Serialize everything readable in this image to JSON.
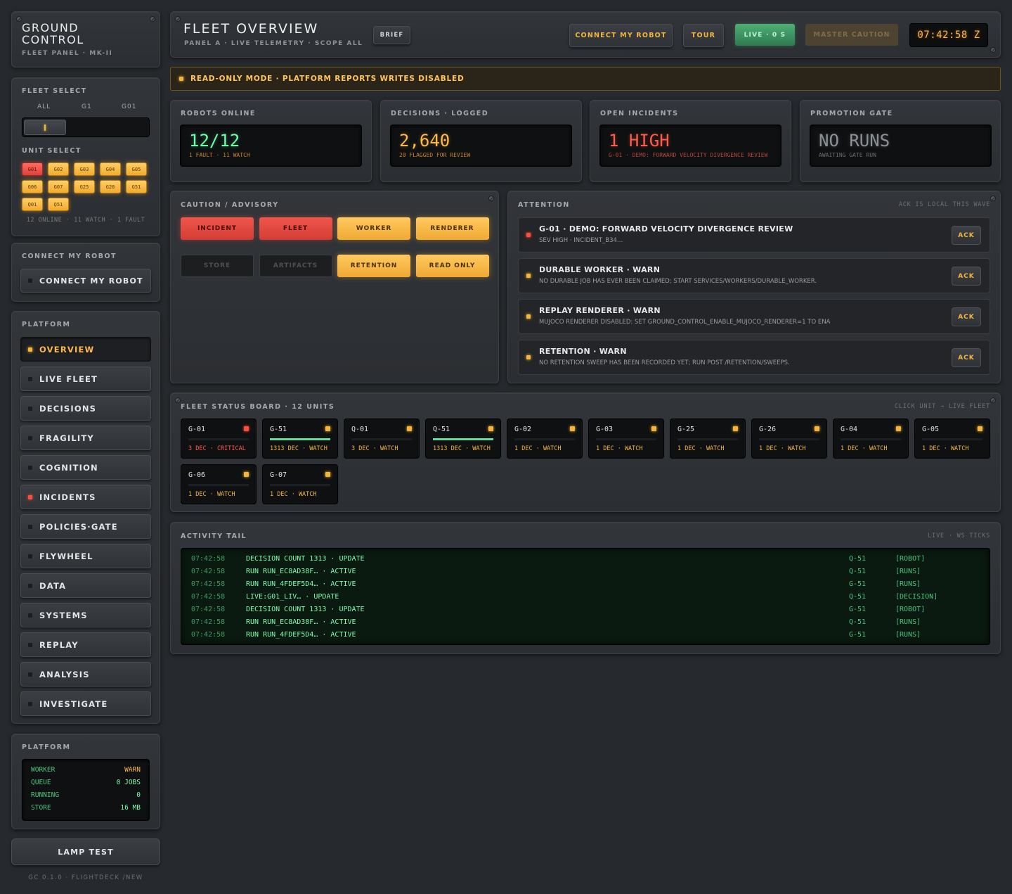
{
  "brand": {
    "title_line1": "GROUND",
    "title_line2": "CONTROL",
    "subtitle": "FLEET PANEL · MK-II"
  },
  "fleet_select": {
    "label": "FLEET SELECT",
    "options": [
      "ALL",
      "G1",
      "G01"
    ],
    "selected": "ALL"
  },
  "unit_select": {
    "label": "UNIT SELECT",
    "units": [
      {
        "id": "G01",
        "state": "fault"
      },
      {
        "id": "G02",
        "state": "watch"
      },
      {
        "id": "G03",
        "state": "watch"
      },
      {
        "id": "G04",
        "state": "watch"
      },
      {
        "id": "G05",
        "state": "watch"
      },
      {
        "id": "G06",
        "state": "watch"
      },
      {
        "id": "G07",
        "state": "watch"
      },
      {
        "id": "G25",
        "state": "watch"
      },
      {
        "id": "G26",
        "state": "watch"
      },
      {
        "id": "G51",
        "state": "watch"
      },
      {
        "id": "Q01",
        "state": "watch"
      },
      {
        "id": "Q51",
        "state": "watch"
      }
    ],
    "summary": "12 ONLINE · 11 WATCH · 1 FAULT"
  },
  "connect": {
    "label": "CONNECT MY ROBOT",
    "button": "CONNECT MY ROBOT"
  },
  "platform_nav": {
    "label": "PLATFORM",
    "items": [
      {
        "label": "OVERVIEW",
        "lamp": "amber",
        "active": true
      },
      {
        "label": "LIVE FLEET",
        "lamp": "off"
      },
      {
        "label": "DECISIONS",
        "lamp": "off"
      },
      {
        "label": "FRAGILITY",
        "lamp": "off"
      },
      {
        "label": "COGNITION",
        "lamp": "off"
      },
      {
        "label": "INCIDENTS",
        "lamp": "red"
      },
      {
        "label": "POLICIES·GATE",
        "lamp": "off"
      },
      {
        "label": "FLYWHEEL",
        "lamp": "off"
      },
      {
        "label": "DATA",
        "lamp": "off"
      },
      {
        "label": "SYSTEMS",
        "lamp": "off"
      },
      {
        "label": "REPLAY",
        "lamp": "off"
      },
      {
        "label": "ANALYSIS",
        "lamp": "off"
      },
      {
        "label": "INVESTIGATE",
        "lamp": "off"
      }
    ]
  },
  "platform_status": {
    "label": "PLATFORM",
    "rows": [
      {
        "key": "WORKER",
        "value": "WARN",
        "warn": true
      },
      {
        "key": "QUEUE",
        "value": "0 JOBS"
      },
      {
        "key": "RUNNING",
        "value": "0"
      },
      {
        "key": "STORE",
        "value": "16 MB"
      }
    ]
  },
  "lamp_test": "LAMP TEST",
  "footer": "GC 0.1.0 · FLIGHTDECK /NEW",
  "header": {
    "title": "FLEET OVERVIEW",
    "subtitle": "PANEL A · LIVE TELEMETRY · SCOPE ALL",
    "brief": "BRIEF",
    "connect": "CONNECT MY ROBOT",
    "tour": "TOUR",
    "live": "LIVE · 0 S",
    "master_caution": "MASTER CAUTION",
    "clock": "07:42:58 Z"
  },
  "banner": "READ-ONLY MODE · PLATFORM REPORTS WRITES DISABLED",
  "stats": [
    {
      "label": "ROBOTS ONLINE",
      "value": "12/12",
      "sub": "1 FAULT · 11 WATCH",
      "color": "#6dffa8",
      "subcolor": "#c9842a"
    },
    {
      "label": "DECISIONS · LOGGED",
      "value": "2,640",
      "sub": "20 FLAGGED FOR REVIEW",
      "color": "#ffb84a",
      "subcolor": "#c9842a"
    },
    {
      "label": "OPEN INCIDENTS",
      "value": "1 HIGH",
      "sub": "G-01 · DEMO: FORWARD VELOCITY DIVERGENCE REVIEW",
      "color": "#ff5c4a",
      "subcolor": "#b8473c"
    },
    {
      "label": "PROMOTION GATE",
      "value": "NO RUNS",
      "sub": "AWAITING GATE RUN",
      "color": "#8d9096",
      "subcolor": "#6b6e73"
    }
  ],
  "caution": {
    "label": "CAUTION / ADVISORY",
    "buttons": [
      {
        "label": "INCIDENT",
        "state": "red"
      },
      {
        "label": "FLEET",
        "state": "red"
      },
      {
        "label": "WORKER",
        "state": "amb"
      },
      {
        "label": "RENDERER",
        "state": "amb"
      },
      {
        "label": "STORE",
        "state": "off"
      },
      {
        "label": "ARTIFACTS",
        "state": "off"
      },
      {
        "label": "RETENTION",
        "state": "amb"
      },
      {
        "label": "READ ONLY",
        "state": "amb"
      }
    ]
  },
  "attention": {
    "label": "ATTENTION",
    "note": "ACK IS LOCAL THIS WAVE",
    "ack": "ACK",
    "items": [
      {
        "title": "G-01 · DEMO: FORWARD VELOCITY DIVERGENCE REVIEW",
        "detail": "SEV HIGH · INCIDENT_B34…",
        "lamp": "red"
      },
      {
        "title": "DURABLE WORKER · WARN",
        "detail": "NO DURABLE JOB HAS EVER BEEN CLAIMED; START SERVICES/WORKERS/DURABLE_WORKER.",
        "lamp": "amber"
      },
      {
        "title": "REPLAY RENDERER · WARN",
        "detail": "MUJOCO RENDERER DISABLED: SET GROUND_CONTROL_ENABLE_MUJOCO_RENDERER=1 TO ENA",
        "lamp": "amber"
      },
      {
        "title": "RETENTION · WARN",
        "detail": "NO RETENTION SWEEP HAS BEEN RECORDED YET; RUN POST /RETENTION/SWEEPS.",
        "lamp": "amber"
      }
    ]
  },
  "status_board": {
    "label": "FLEET STATUS BOARD · 12 UNITS",
    "note": "CLICK UNIT → LIVE FLEET",
    "units": [
      {
        "name": "G-01",
        "status": "3 DEC · CRITICAL",
        "critical": true,
        "progress": 0
      },
      {
        "name": "G-51",
        "status": "1313 DEC · WATCH",
        "progress": 1
      },
      {
        "name": "Q-01",
        "status": "3 DEC · WATCH",
        "progress": 0
      },
      {
        "name": "Q-51",
        "status": "1313 DEC · WATCH",
        "progress": 1
      },
      {
        "name": "G-02",
        "status": "1 DEC · WATCH",
        "progress": 0
      },
      {
        "name": "G-03",
        "status": "1 DEC · WATCH",
        "progress": 0
      },
      {
        "name": "G-25",
        "status": "1 DEC · WATCH",
        "progress": 0
      },
      {
        "name": "G-26",
        "status": "1 DEC · WATCH",
        "progress": 0
      },
      {
        "name": "G-04",
        "status": "1 DEC · WATCH",
        "progress": 0
      },
      {
        "name": "G-05",
        "status": "1 DEC · WATCH",
        "progress": 0
      },
      {
        "name": "G-06",
        "status": "1 DEC · WATCH",
        "progress": 0
      },
      {
        "name": "G-07",
        "status": "1 DEC · WATCH",
        "progress": 0
      }
    ]
  },
  "activity": {
    "label": "ACTIVITY TAIL",
    "note": "LIVE · WS TICKS",
    "rows": [
      {
        "time": "07:42:58",
        "msg": "DECISION COUNT 1313 · UPDATE",
        "unit": "Q-51",
        "tag": "[ROBOT]"
      },
      {
        "time": "07:42:58",
        "msg": "RUN RUN_EC8AD38F… · ACTIVE",
        "unit": "Q-51",
        "tag": "[RUNS]"
      },
      {
        "time": "07:42:58",
        "msg": "RUN RUN_4FDEF5D4… · ACTIVE",
        "unit": "G-51",
        "tag": "[RUNS]"
      },
      {
        "time": "07:42:58",
        "msg": "LIVE:G01_LIV… · UPDATE",
        "unit": "Q-51",
        "tag": "[DECISION]"
      },
      {
        "time": "07:42:58",
        "msg": "DECISION COUNT 1313 · UPDATE",
        "unit": "G-51",
        "tag": "[ROBOT]"
      },
      {
        "time": "07:42:58",
        "msg": "RUN RUN_EC8AD38F… · ACTIVE",
        "unit": "Q-51",
        "tag": "[RUNS]"
      },
      {
        "time": "07:42:58",
        "msg": "RUN RUN_4FDEF5D4… · ACTIVE",
        "unit": "G-51",
        "tag": "[RUNS]"
      }
    ]
  }
}
